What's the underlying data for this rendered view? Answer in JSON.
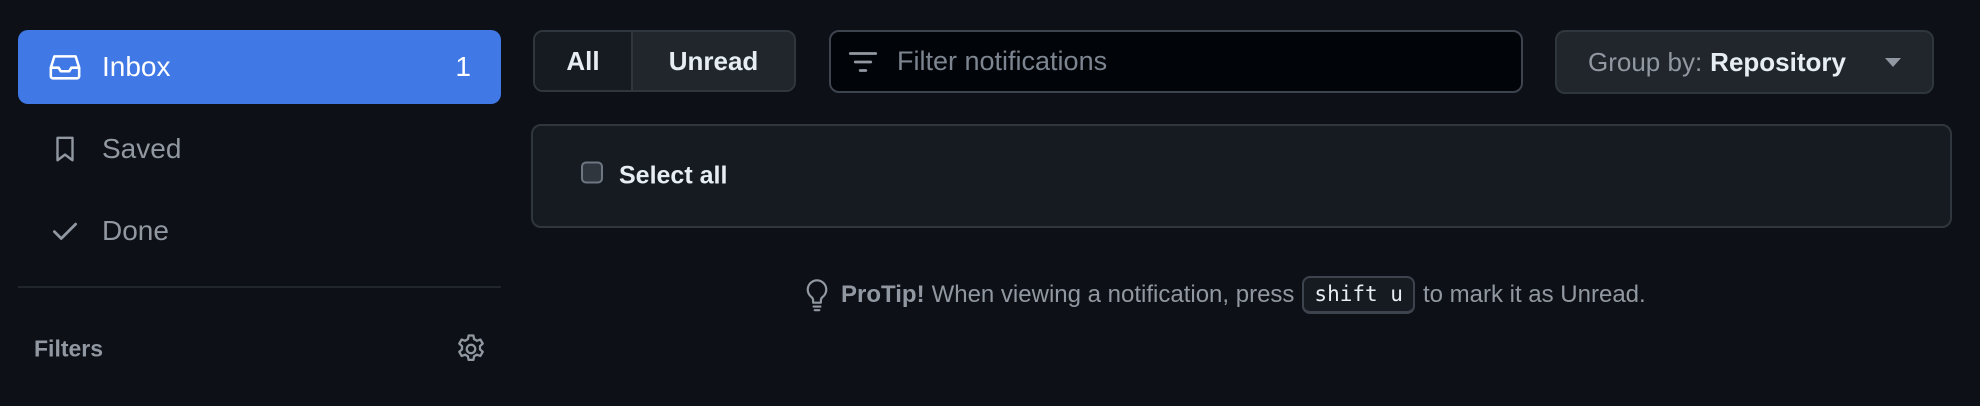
{
  "sidebar": {
    "items": [
      {
        "label": "Inbox",
        "count": "1",
        "icon": "inbox-icon",
        "active": true
      },
      {
        "label": "Saved",
        "icon": "bookmark-icon"
      },
      {
        "label": "Done",
        "icon": "check-icon"
      }
    ],
    "filters_label": "Filters",
    "filters_icon": "gear-icon"
  },
  "toolbar": {
    "tabs": [
      {
        "label": "All"
      },
      {
        "label": "Unread"
      }
    ],
    "filter": {
      "placeholder": "Filter notifications",
      "value": "",
      "icon": "filter-icon"
    },
    "group_by": {
      "prefix": "Group by:",
      "value": "Repository",
      "icon": "triangle-down-icon"
    }
  },
  "list": {
    "select_all_label": "Select all"
  },
  "protip": {
    "icon": "light-bulb-icon",
    "strong": "ProTip!",
    "before": "When viewing a notification, press",
    "key": "shift u",
    "after": "to mark it as Unread."
  },
  "colors": {
    "background": "#0d1117",
    "accent": "#4078e6",
    "panel": "#161b22",
    "border": "#30363d",
    "muted_text": "#9198a1",
    "text": "#e6edf3"
  }
}
